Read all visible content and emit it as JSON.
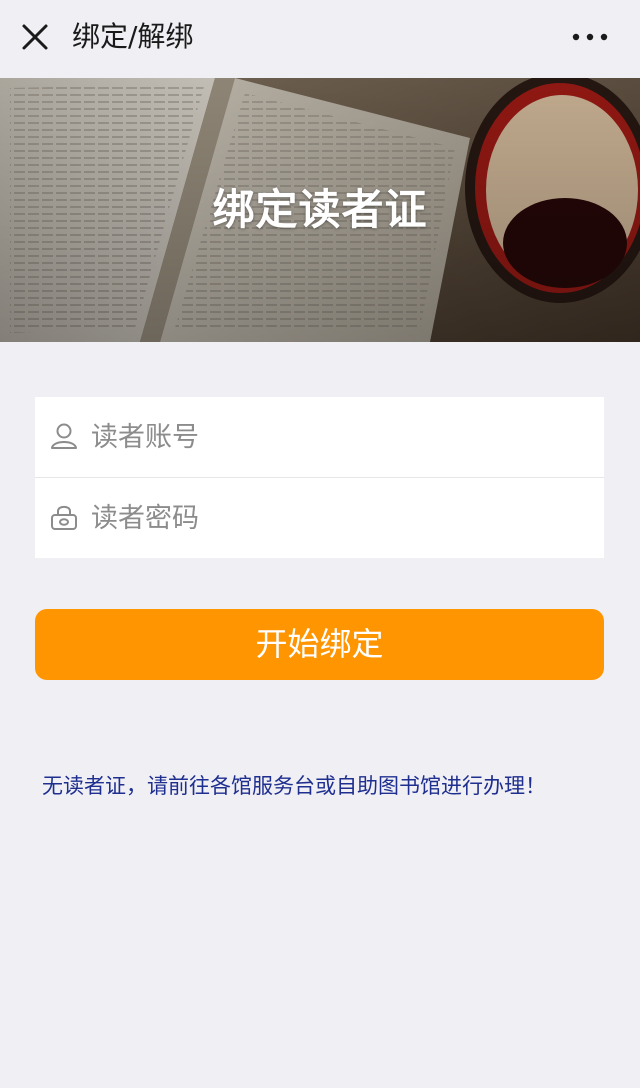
{
  "nav": {
    "title": "绑定/解绑",
    "close_icon": "close-icon",
    "more_icon": "more-icon"
  },
  "banner": {
    "title": "绑定读者证",
    "image": "open-book-and-coffee-cup"
  },
  "form": {
    "account": {
      "placeholder": "读者账号",
      "value": "",
      "icon": "user-icon"
    },
    "password": {
      "placeholder": "读者密码",
      "value": "",
      "icon": "lock-icon"
    }
  },
  "bind_button": {
    "label": "开始绑定",
    "color": "#ff9500"
  },
  "notice": {
    "text": "无读者证，请前往各馆服务台或自助图书馆进行办理！",
    "color": "#1f2f8f"
  },
  "colors": {
    "background": "#efeff4",
    "accent": "#ff9500"
  }
}
